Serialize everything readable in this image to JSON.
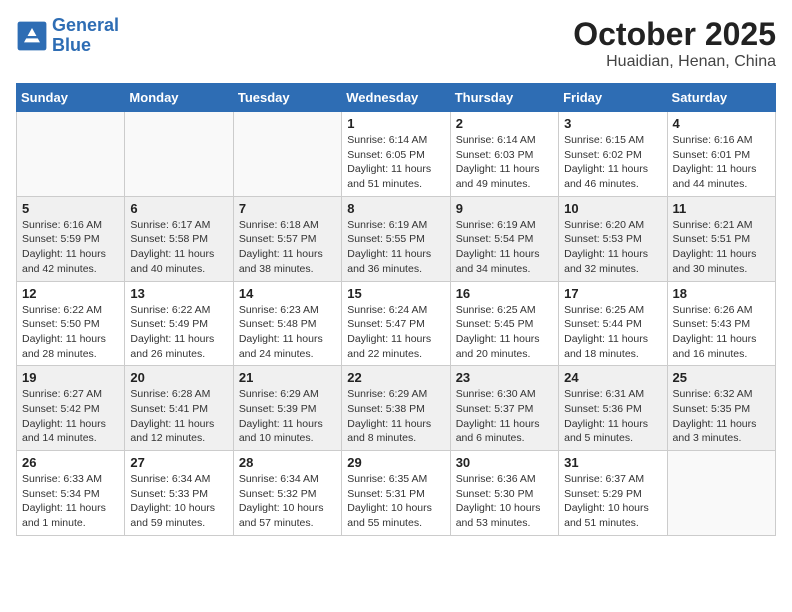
{
  "logo": {
    "line1": "General",
    "line2": "Blue"
  },
  "title": "October 2025",
  "subtitle": "Huaidian, Henan, China",
  "weekdays": [
    "Sunday",
    "Monday",
    "Tuesday",
    "Wednesday",
    "Thursday",
    "Friday",
    "Saturday"
  ],
  "weeks": [
    [
      {
        "day": "",
        "info": ""
      },
      {
        "day": "",
        "info": ""
      },
      {
        "day": "",
        "info": ""
      },
      {
        "day": "1",
        "info": "Sunrise: 6:14 AM\nSunset: 6:05 PM\nDaylight: 11 hours\nand 51 minutes."
      },
      {
        "day": "2",
        "info": "Sunrise: 6:14 AM\nSunset: 6:03 PM\nDaylight: 11 hours\nand 49 minutes."
      },
      {
        "day": "3",
        "info": "Sunrise: 6:15 AM\nSunset: 6:02 PM\nDaylight: 11 hours\nand 46 minutes."
      },
      {
        "day": "4",
        "info": "Sunrise: 6:16 AM\nSunset: 6:01 PM\nDaylight: 11 hours\nand 44 minutes."
      }
    ],
    [
      {
        "day": "5",
        "info": "Sunrise: 6:16 AM\nSunset: 5:59 PM\nDaylight: 11 hours\nand 42 minutes."
      },
      {
        "day": "6",
        "info": "Sunrise: 6:17 AM\nSunset: 5:58 PM\nDaylight: 11 hours\nand 40 minutes."
      },
      {
        "day": "7",
        "info": "Sunrise: 6:18 AM\nSunset: 5:57 PM\nDaylight: 11 hours\nand 38 minutes."
      },
      {
        "day": "8",
        "info": "Sunrise: 6:19 AM\nSunset: 5:55 PM\nDaylight: 11 hours\nand 36 minutes."
      },
      {
        "day": "9",
        "info": "Sunrise: 6:19 AM\nSunset: 5:54 PM\nDaylight: 11 hours\nand 34 minutes."
      },
      {
        "day": "10",
        "info": "Sunrise: 6:20 AM\nSunset: 5:53 PM\nDaylight: 11 hours\nand 32 minutes."
      },
      {
        "day": "11",
        "info": "Sunrise: 6:21 AM\nSunset: 5:51 PM\nDaylight: 11 hours\nand 30 minutes."
      }
    ],
    [
      {
        "day": "12",
        "info": "Sunrise: 6:22 AM\nSunset: 5:50 PM\nDaylight: 11 hours\nand 28 minutes."
      },
      {
        "day": "13",
        "info": "Sunrise: 6:22 AM\nSunset: 5:49 PM\nDaylight: 11 hours\nand 26 minutes."
      },
      {
        "day": "14",
        "info": "Sunrise: 6:23 AM\nSunset: 5:48 PM\nDaylight: 11 hours\nand 24 minutes."
      },
      {
        "day": "15",
        "info": "Sunrise: 6:24 AM\nSunset: 5:47 PM\nDaylight: 11 hours\nand 22 minutes."
      },
      {
        "day": "16",
        "info": "Sunrise: 6:25 AM\nSunset: 5:45 PM\nDaylight: 11 hours\nand 20 minutes."
      },
      {
        "day": "17",
        "info": "Sunrise: 6:25 AM\nSunset: 5:44 PM\nDaylight: 11 hours\nand 18 minutes."
      },
      {
        "day": "18",
        "info": "Sunrise: 6:26 AM\nSunset: 5:43 PM\nDaylight: 11 hours\nand 16 minutes."
      }
    ],
    [
      {
        "day": "19",
        "info": "Sunrise: 6:27 AM\nSunset: 5:42 PM\nDaylight: 11 hours\nand 14 minutes."
      },
      {
        "day": "20",
        "info": "Sunrise: 6:28 AM\nSunset: 5:41 PM\nDaylight: 11 hours\nand 12 minutes."
      },
      {
        "day": "21",
        "info": "Sunrise: 6:29 AM\nSunset: 5:39 PM\nDaylight: 11 hours\nand 10 minutes."
      },
      {
        "day": "22",
        "info": "Sunrise: 6:29 AM\nSunset: 5:38 PM\nDaylight: 11 hours\nand 8 minutes."
      },
      {
        "day": "23",
        "info": "Sunrise: 6:30 AM\nSunset: 5:37 PM\nDaylight: 11 hours\nand 6 minutes."
      },
      {
        "day": "24",
        "info": "Sunrise: 6:31 AM\nSunset: 5:36 PM\nDaylight: 11 hours\nand 5 minutes."
      },
      {
        "day": "25",
        "info": "Sunrise: 6:32 AM\nSunset: 5:35 PM\nDaylight: 11 hours\nand 3 minutes."
      }
    ],
    [
      {
        "day": "26",
        "info": "Sunrise: 6:33 AM\nSunset: 5:34 PM\nDaylight: 11 hours\nand 1 minute."
      },
      {
        "day": "27",
        "info": "Sunrise: 6:34 AM\nSunset: 5:33 PM\nDaylight: 10 hours\nand 59 minutes."
      },
      {
        "day": "28",
        "info": "Sunrise: 6:34 AM\nSunset: 5:32 PM\nDaylight: 10 hours\nand 57 minutes."
      },
      {
        "day": "29",
        "info": "Sunrise: 6:35 AM\nSunset: 5:31 PM\nDaylight: 10 hours\nand 55 minutes."
      },
      {
        "day": "30",
        "info": "Sunrise: 6:36 AM\nSunset: 5:30 PM\nDaylight: 10 hours\nand 53 minutes."
      },
      {
        "day": "31",
        "info": "Sunrise: 6:37 AM\nSunset: 5:29 PM\nDaylight: 10 hours\nand 51 minutes."
      },
      {
        "day": "",
        "info": ""
      }
    ]
  ]
}
